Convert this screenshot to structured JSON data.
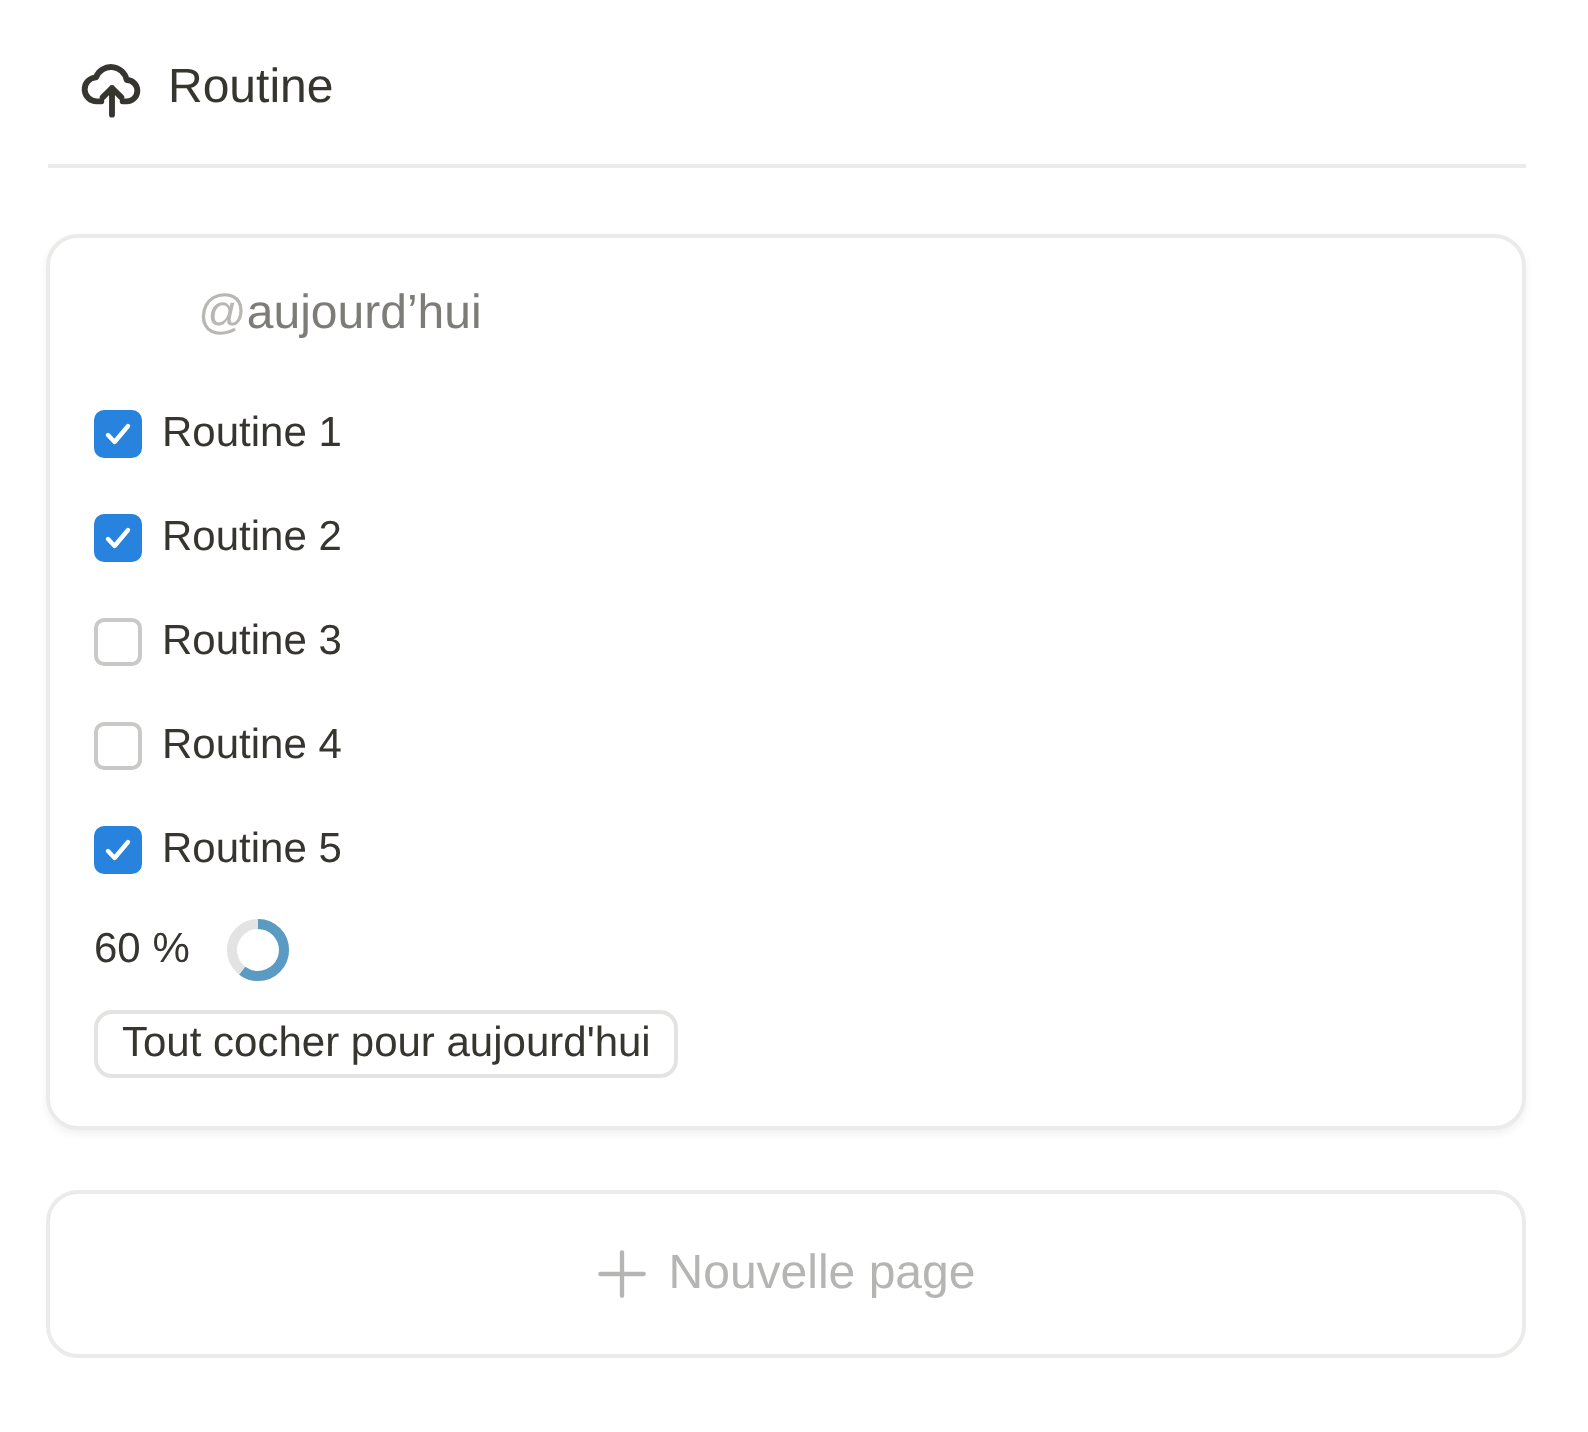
{
  "header": {
    "title": "Routine"
  },
  "card": {
    "mention": {
      "symbol": "@",
      "label": "aujourd’hui"
    },
    "items": [
      {
        "label": "Routine 1",
        "checked": true
      },
      {
        "label": "Routine 2",
        "checked": true
      },
      {
        "label": "Routine 3",
        "checked": false
      },
      {
        "label": "Routine 4",
        "checked": false
      },
      {
        "label": "Routine 5",
        "checked": true
      }
    ],
    "progress": {
      "reading": "60 %"
    },
    "button": "Tout cocher pour aujourd'hui"
  },
  "new_page": {
    "label": "Nouvelle page"
  }
}
